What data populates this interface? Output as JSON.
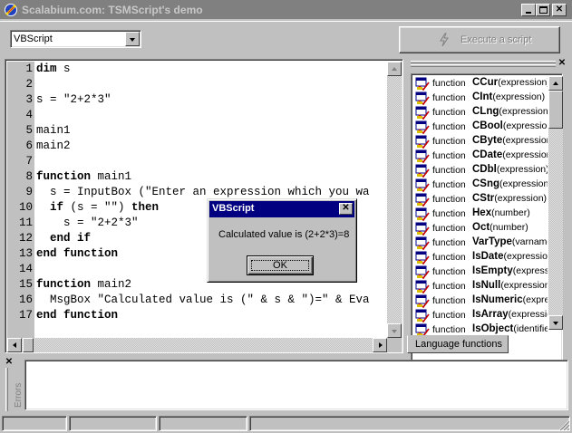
{
  "window": {
    "title": "Scalabium.com: TSMScript's demo"
  },
  "toolbar": {
    "language": "VBScript",
    "execute_label": "Execute a script"
  },
  "editor": {
    "lines": [
      {
        "n": "1",
        "parts": [
          {
            "t": "dim",
            "b": true
          },
          {
            "t": " s"
          }
        ]
      },
      {
        "n": "2",
        "parts": []
      },
      {
        "n": "3",
        "parts": [
          {
            "t": "s = \"2+2*3\""
          }
        ]
      },
      {
        "n": "4",
        "parts": []
      },
      {
        "n": "5",
        "parts": [
          {
            "t": "main1"
          }
        ]
      },
      {
        "n": "6",
        "parts": [
          {
            "t": "main2"
          }
        ]
      },
      {
        "n": "7",
        "parts": []
      },
      {
        "n": "8",
        "parts": [
          {
            "t": "function",
            "b": true
          },
          {
            "t": " main1"
          }
        ]
      },
      {
        "n": "9",
        "parts": [
          {
            "t": "  s = InputBox (\"Enter an expression which you wa"
          }
        ]
      },
      {
        "n": "10",
        "parts": [
          {
            "t": "  "
          },
          {
            "t": "if",
            "b": true
          },
          {
            "t": " (s = \"\") "
          },
          {
            "t": "then",
            "b": true
          }
        ]
      },
      {
        "n": "11",
        "parts": [
          {
            "t": "    s = \"2+2*3\""
          }
        ]
      },
      {
        "n": "12",
        "parts": [
          {
            "t": "  "
          },
          {
            "t": "end if",
            "b": true
          }
        ]
      },
      {
        "n": "13",
        "parts": [
          {
            "t": "end function",
            "b": true
          }
        ]
      },
      {
        "n": "14",
        "parts": []
      },
      {
        "n": "15",
        "parts": [
          {
            "t": "function",
            "b": true
          },
          {
            "t": " main2"
          }
        ]
      },
      {
        "n": "16",
        "parts": [
          {
            "t": "  MsgBox \"Calculated value is (\" & s & \")=\" & Eva"
          }
        ]
      },
      {
        "n": "17",
        "parts": [
          {
            "t": "end function",
            "b": true
          }
        ]
      }
    ]
  },
  "functions": {
    "keyword": "function",
    "items": [
      {
        "name": "CCur",
        "params": "(expression)"
      },
      {
        "name": "CInt",
        "params": "(expression)"
      },
      {
        "name": "CLng",
        "params": "(expression)"
      },
      {
        "name": "CBool",
        "params": "(expression)"
      },
      {
        "name": "CByte",
        "params": "(expression)"
      },
      {
        "name": "CDate",
        "params": "(expression)"
      },
      {
        "name": "CDbl",
        "params": "(expression)"
      },
      {
        "name": "CSng",
        "params": "(expression)"
      },
      {
        "name": "CStr",
        "params": "(expression)"
      },
      {
        "name": "Hex",
        "params": "(number)"
      },
      {
        "name": "Oct",
        "params": "(number)"
      },
      {
        "name": "VarType",
        "params": "(varname)"
      },
      {
        "name": "IsDate",
        "params": "(expression)"
      },
      {
        "name": "IsEmpty",
        "params": "(expression)"
      },
      {
        "name": "IsNull",
        "params": "(expression)"
      },
      {
        "name": "IsNumeric",
        "params": "(expression)"
      },
      {
        "name": "IsArray",
        "params": "(expression)"
      },
      {
        "name": "IsObject",
        "params": "(identifier)"
      }
    ]
  },
  "tabs": {
    "language_functions": "Language functions"
  },
  "errors": {
    "label": "Errors",
    "text": ""
  },
  "dialog": {
    "title": "VBScript",
    "message": "Calculated value is (2+2*3)=8",
    "ok_label": "OK"
  }
}
